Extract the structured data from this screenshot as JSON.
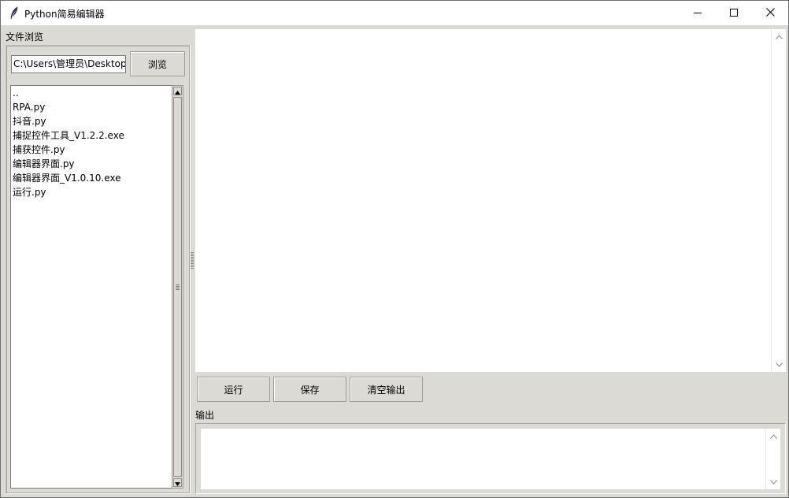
{
  "window": {
    "title": "Python简易编辑器"
  },
  "file_browser": {
    "label": "文件浏览",
    "path_value": "C:\\Users\\管理员\\Desktop",
    "browse_label": "浏览",
    "files": [
      "..",
      "RPA.py",
      "抖音.py",
      "捕捉控件工具_V1.2.2.exe",
      "捕获控件.py",
      "编辑器界面.py",
      "编辑器界面_V1.0.10.exe",
      "运行.py"
    ]
  },
  "editor": {
    "content": ""
  },
  "toolbar": {
    "run_label": "运行",
    "save_label": "保存",
    "clear_label": "清空输出"
  },
  "output": {
    "label": "输出",
    "content": ""
  },
  "icons": {
    "app": "feather-icon",
    "minimize": "minimize-icon",
    "maximize": "maximize-icon",
    "close": "close-icon"
  }
}
